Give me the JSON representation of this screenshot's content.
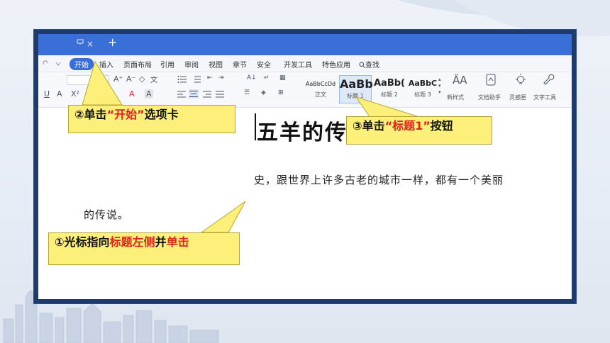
{
  "titlebar": {
    "close_glyph": "×",
    "add_glyph": "+"
  },
  "menu": {
    "tabs": [
      {
        "label": "开始",
        "active": true
      },
      {
        "label": "插入"
      },
      {
        "label": "页面布局"
      },
      {
        "label": "引用"
      },
      {
        "label": "审阅"
      },
      {
        "label": "视图"
      },
      {
        "label": "章节"
      },
      {
        "label": "安全"
      },
      {
        "label": "开发工具"
      },
      {
        "label": "特色应用"
      },
      {
        "label": "查找"
      }
    ]
  },
  "ribbon": {
    "styles": [
      {
        "sample": "AaBbCcDd",
        "name": "正文"
      },
      {
        "sample": "AaBb",
        "name": "标题 1",
        "selected": true
      },
      {
        "sample": "AaBb(",
        "name": "标题 2"
      },
      {
        "sample": "AaBbC",
        "name": "标题 3"
      }
    ],
    "new_style": "新样式",
    "doc_helper": "文档助手",
    "inspiration": "灵感匣",
    "text_tools": "文字工具"
  },
  "document": {
    "title": "五羊的传说",
    "line1": "史，跟世界上许多古老的城市一样，都有一个美丽",
    "line2": "的传说。"
  },
  "callouts": {
    "c1": {
      "part1": "①光标指向",
      "part2": "标题左侧",
      "part3": "并",
      "part4": "单击"
    },
    "c2": {
      "part1": "②单击",
      "part2": "“开始”",
      "part3": "选项卡"
    },
    "c3": {
      "part1": "③单击",
      "part2": "“标题1”",
      "part3": "按钮"
    }
  },
  "colors": {
    "accent": "#3b6fd8",
    "frame": "#1f3a6b",
    "callout_bg": "#fdf07a",
    "highlight_text": "#e0231b"
  }
}
